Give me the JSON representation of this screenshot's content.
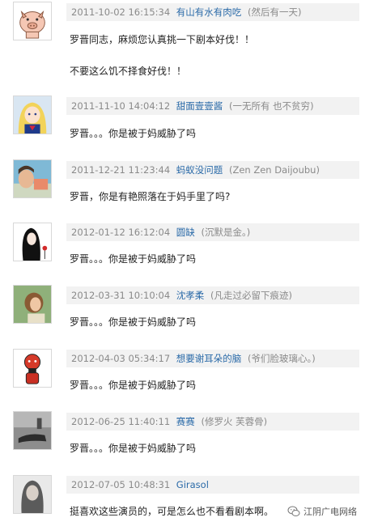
{
  "comments": [
    {
      "timestamp": "2011-10-02 16:15:34",
      "username": "有山有水有肉吃",
      "motto": "(然后有一天)",
      "lines": [
        "罗晋同志，麻烦您认真挑一下剧本好伐！！",
        "不要这么饥不择食好伐！！"
      ]
    },
    {
      "timestamp": "2011-11-10 14:04:12",
      "username": "甜面壹壹酱",
      "motto": "(一无所有 也不贫穷)",
      "lines": [
        "罗晋。。。你是被于妈威胁了吗"
      ]
    },
    {
      "timestamp": "2011-12-21 11:23:44",
      "username": "蚂蚁没问题",
      "motto": "(Zen Zen Daijoubu)",
      "lines": [
        "罗晋，你是有艳照落在于妈手里了吗?"
      ]
    },
    {
      "timestamp": "2012-01-12 16:12:04",
      "username": "圆缺",
      "motto": "(沉默是金。)",
      "lines": [
        "罗晋。。。你是被于妈威胁了吗"
      ]
    },
    {
      "timestamp": "2012-03-31 10:10:04",
      "username": "沈孝柔",
      "motto": "(凡走过必留下痕迹)",
      "lines": [
        "罗晋。。。你是被于妈威胁了吗"
      ]
    },
    {
      "timestamp": "2012-04-03 05:34:17",
      "username": "想要谢耳朵的脑",
      "motto": "(爷们脸玻璃心。)",
      "lines": [
        "罗晋。。。你是被于妈威胁了吗"
      ]
    },
    {
      "timestamp": "2012-06-25 11:40:11",
      "username": "赛赛",
      "motto": "(修罗火 芙蓉骨)",
      "lines": [
        "罗晋。。。你是被于妈威胁了吗"
      ]
    },
    {
      "timestamp": "2012-07-05 10:48:31",
      "username": "Girasol",
      "motto": "",
      "lines": [
        "挺喜欢这些演员的，可是怎么也不看看剧本啊。"
      ]
    }
  ],
  "watermark": {
    "text": "江阴广电网络",
    "icon": "wechat-icon"
  }
}
